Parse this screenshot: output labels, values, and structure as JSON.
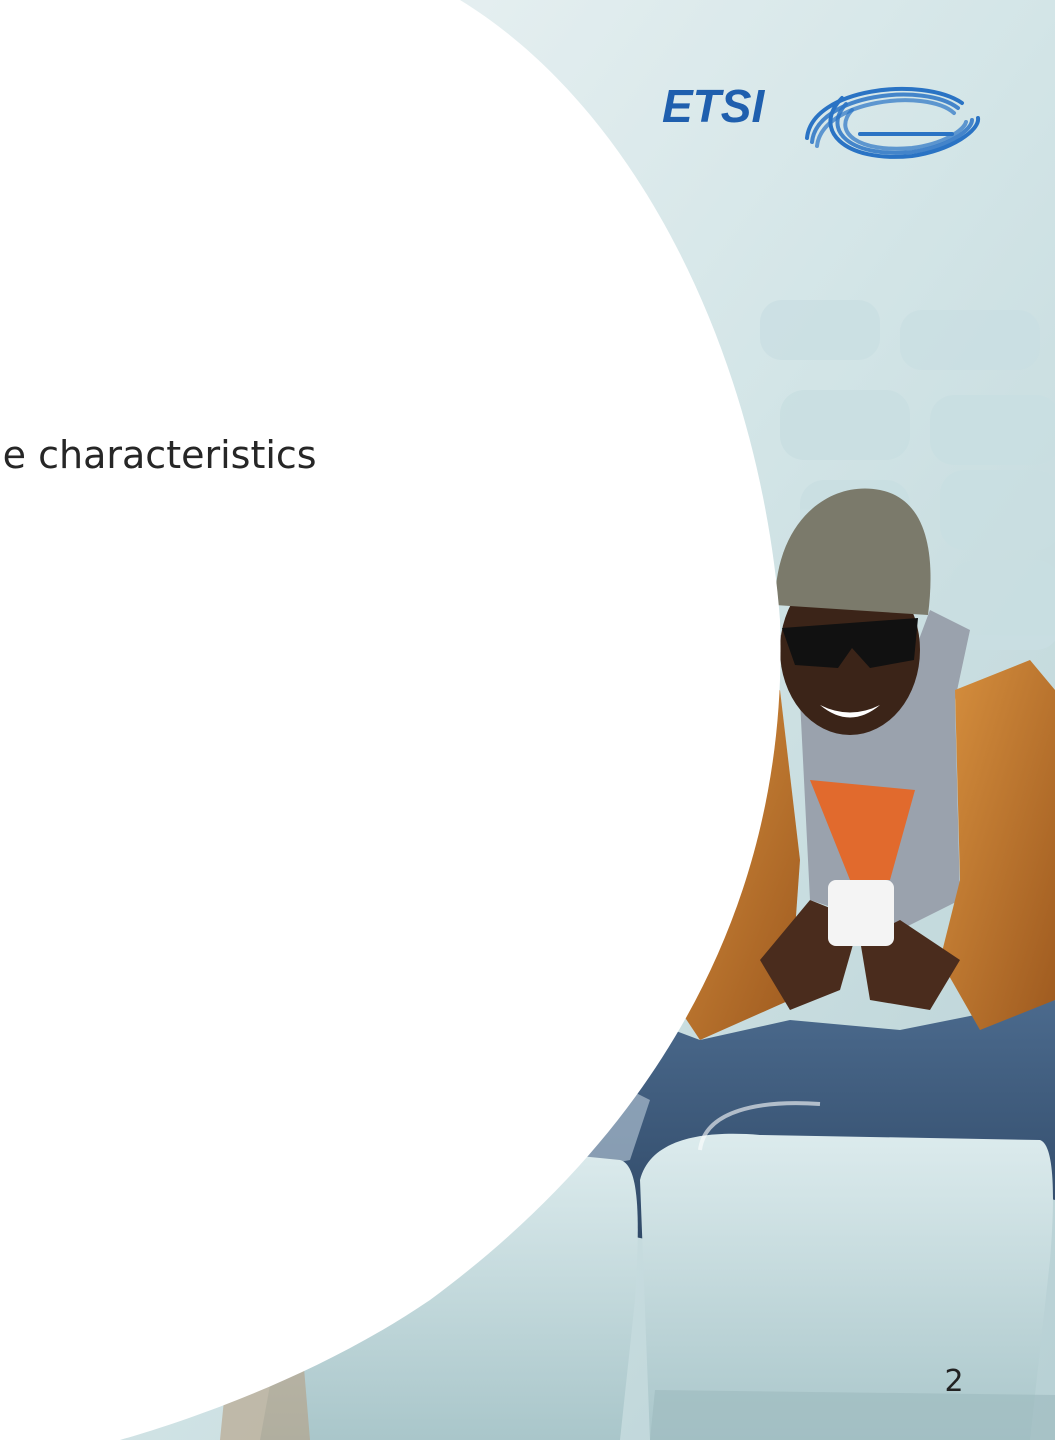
{
  "slide": {
    "body_text": "ble characteristics",
    "page_number": "2"
  },
  "logo": {
    "name": "ETSI",
    "icon": "etsi-logo-icon"
  },
  "photo": {
    "icon": "stadium-person-photo"
  },
  "colors": {
    "brand_blue": "#1f5fae",
    "seat": "#c7dde0",
    "jacket": "#c5772b",
    "jeans": "#3f5a7a"
  }
}
